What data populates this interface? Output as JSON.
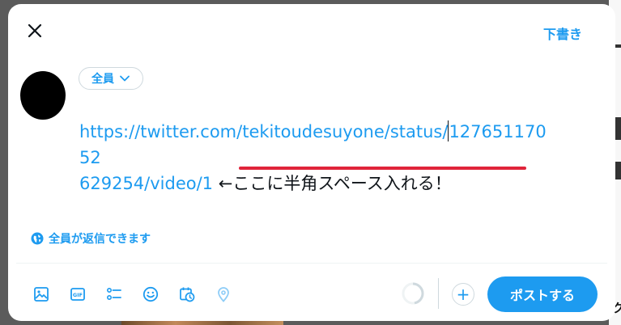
{
  "header": {
    "close_icon": "close-icon",
    "drafts_label": "下書き"
  },
  "composer": {
    "audience_label": "全員",
    "url_line1": "https://twitter.com/tekitoudesuyone/status/",
    "url_line1_tail": "12765117052",
    "url_line2": "629254/video/1",
    "annotation": "←ここに半角スペース入れる！",
    "reply_setting": "全員が返信できます"
  },
  "toolbar": {
    "icons": [
      "image-icon",
      "gif-icon",
      "poll-icon",
      "emoji-icon",
      "schedule-icon",
      "location-icon"
    ],
    "gif_text": "GIF",
    "add_label": "+",
    "post_label": "ポストする"
  },
  "colors": {
    "accent": "#1d9bf0",
    "annotation_underline": "#e0243a"
  },
  "backdrop": {
    "right_fragment": "ク"
  }
}
